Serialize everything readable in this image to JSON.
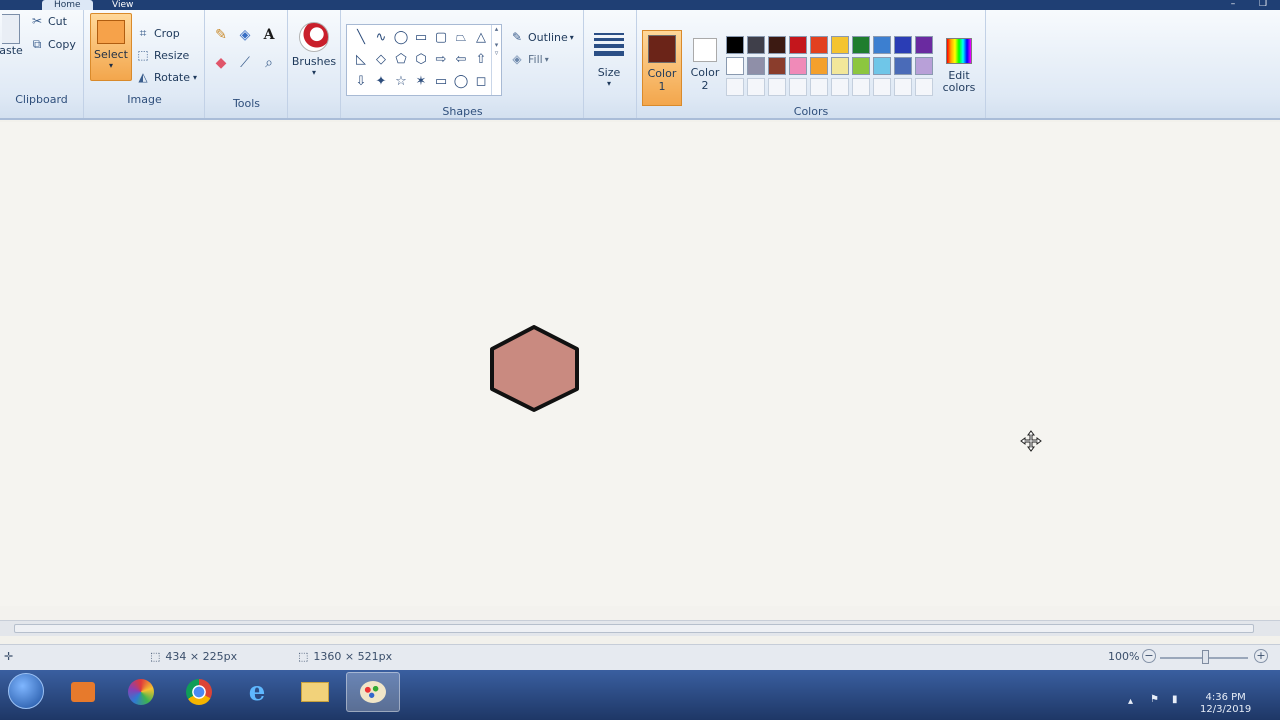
{
  "ribbon_tabs": {
    "home": "Home",
    "view": "View"
  },
  "clipboard": {
    "paste_label": "aste",
    "cut_label": "Cut",
    "copy_label": "Copy",
    "group_label": "Clipboard"
  },
  "image": {
    "select_label": "Select",
    "crop_label": "Crop",
    "resize_label": "Resize",
    "rotate_label": "Rotate",
    "group_label": "Image"
  },
  "tools": {
    "group_label": "Tools",
    "items": [
      "pencil-icon",
      "fill-icon",
      "text-icon",
      "eraser-icon",
      "color-picker-icon",
      "magnifier-icon"
    ]
  },
  "brushes": {
    "label": "Brushes"
  },
  "shapes": {
    "group_label": "Shapes",
    "outline_label": "Outline",
    "fill_label": "Fill",
    "items": [
      "╲",
      "∿",
      "◯",
      "▭",
      "▢",
      "⏢",
      "△",
      "◺",
      "◇",
      "⬠",
      "⬡",
      "⇨",
      "⇦",
      "⇧",
      "⇩",
      "✦",
      "☆",
      "✶",
      "▭",
      "◯",
      "◻"
    ]
  },
  "size": {
    "label": "Size"
  },
  "colors": {
    "color1_label": "Color\n1",
    "color1_value": "#6b2418",
    "color2_label": "Color\n2",
    "color2_value": "#ffffff",
    "group_label": "Colors",
    "edit_label": "Edit colors",
    "palette_row1": [
      "#000000",
      "#3f3f4a",
      "#3c1a12",
      "#c4161c",
      "#e2401f",
      "#f4c430",
      "#1e7d2e",
      "#3c7fd0",
      "#2a3db5",
      "#6a2aa0"
    ],
    "palette_row2": [
      "#ffffff",
      "#8f8fa8",
      "#8a3d2c",
      "#f08ab8",
      "#f4a02c",
      "#f2e79a",
      "#8cc63f",
      "#6fc6e8",
      "#4a6bb8",
      "#b8a0d8"
    ]
  },
  "canvas": {
    "shape_fill": "#c98a80",
    "shape_stroke": "#111111"
  },
  "status": {
    "selection_size": "434 × 225px",
    "image_size": "1360 × 521px",
    "zoom": "100%"
  },
  "taskbar": {
    "time": "4:36 PM",
    "date": "12/3/2019"
  }
}
